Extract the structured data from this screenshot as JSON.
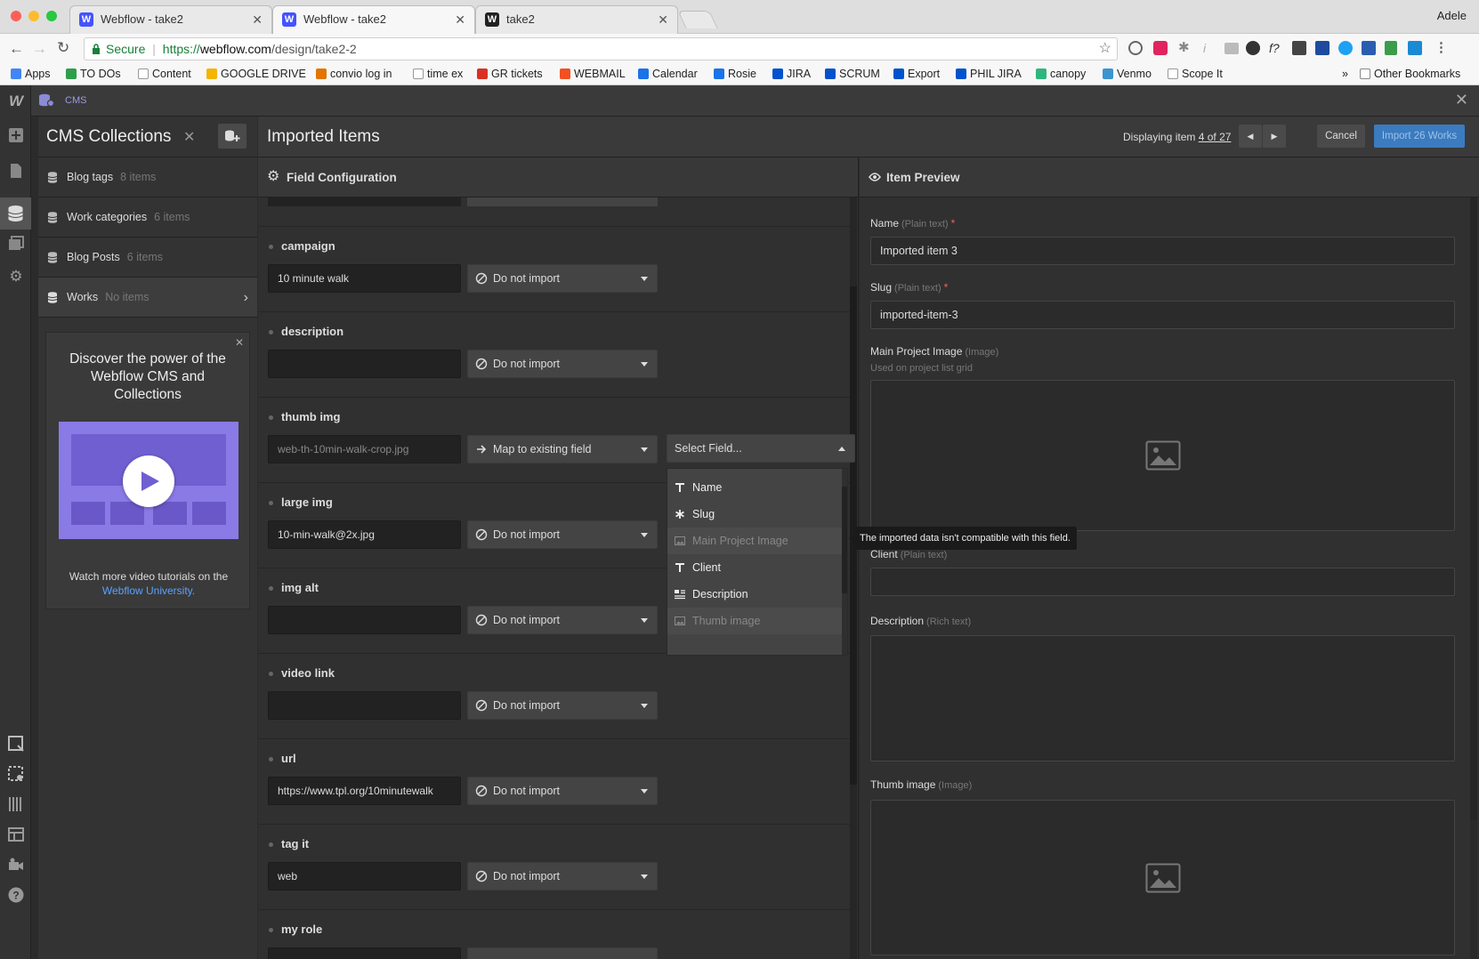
{
  "browser": {
    "tabs": [
      {
        "title": "Webflow - take2",
        "favicon": "webflow-w-icon"
      },
      {
        "title": "Webflow - take2",
        "favicon": "webflow-w-icon"
      },
      {
        "title": "take2",
        "favicon": "webflow-w-icon"
      }
    ],
    "user": "Adele",
    "secure_label": "Secure",
    "url_scheme": "https://",
    "url_host": "webflow.com",
    "url_path": "/design/take2-2",
    "bookmarks": [
      {
        "label": "Apps",
        "color": "#4285f4"
      },
      {
        "label": "TO DOs",
        "color": "#2e9e4a"
      },
      {
        "label": "Content",
        "color": "#999999"
      },
      {
        "label": "GOOGLE DRIVE",
        "color": "#f4b400"
      },
      {
        "label": "convio log in",
        "color": "#e37400"
      },
      {
        "label": "time ex",
        "color": "#999999"
      },
      {
        "label": "GR tickets",
        "color": "#d93025"
      },
      {
        "label": "WEBMAIL",
        "color": "#f25022"
      },
      {
        "label": "Calendar",
        "color": "#1a73e8"
      },
      {
        "label": "Rosie",
        "color": "#1a73e8"
      },
      {
        "label": "JIRA",
        "color": "#0052cc"
      },
      {
        "label": "SCRUM",
        "color": "#0052cc"
      },
      {
        "label": "Export",
        "color": "#0052cc"
      },
      {
        "label": "PHIL JIRA",
        "color": "#0052cc"
      },
      {
        "label": "canopy",
        "color": "#2eb67d"
      },
      {
        "label": "Venmo",
        "color": "#3d95ce"
      },
      {
        "label": "Scope It",
        "color": "#999999"
      }
    ],
    "overflow_label": "»",
    "other_bookmarks": "Other Bookmarks"
  },
  "cms": {
    "top_label": "CMS",
    "collections_title": "CMS Collections",
    "collections": [
      {
        "name": "Blog tags",
        "count": "8 items"
      },
      {
        "name": "Work categories",
        "count": "6 items"
      },
      {
        "name": "Blog Posts",
        "count": "6 items"
      },
      {
        "name": "Works",
        "count": "No items"
      }
    ],
    "promo": {
      "title": "Discover the power of the Webflow CMS and Collections",
      "footer_text": "Watch more video tutorials on the",
      "link_text": "Webflow University",
      "link_suffix": "."
    }
  },
  "import": {
    "title": "Imported Items",
    "display_prefix": "Displaying item",
    "display_link": "4 of 27",
    "cancel_label": "Cancel",
    "import_label": "Import 26 Works",
    "field_config_title": "Field Configuration",
    "item_preview_title": "Item Preview",
    "fields": [
      {
        "name": "campaign",
        "value": "10 minute walk",
        "action": "Do not import"
      },
      {
        "name": "description",
        "value": "",
        "action": "Do not import"
      },
      {
        "name": "thumb img",
        "value": "web-th-10min-walk-crop.jpg",
        "action": "Map to existing field"
      },
      {
        "name": "large img",
        "value": "10-min-walk@2x.jpg",
        "action": "Do not import"
      },
      {
        "name": "img alt",
        "value": "",
        "action": "Do not import"
      },
      {
        "name": "video link",
        "value": "",
        "action": "Do not import"
      },
      {
        "name": "url",
        "value": "https://www.tpl.org/10minutewalk",
        "action": "Do not import"
      },
      {
        "name": "tag it",
        "value": "web",
        "action": "Do not import"
      },
      {
        "name": "my role",
        "value": "",
        "action": ""
      }
    ],
    "select_field": {
      "placeholder": "Select Field...",
      "options": [
        {
          "label": "Name",
          "icon": "text-icon",
          "disabled": false
        },
        {
          "label": "Slug",
          "icon": "asterisk-icon",
          "disabled": false
        },
        {
          "label": "Main Project Image",
          "icon": "image-icon",
          "disabled": true
        },
        {
          "label": "Client",
          "icon": "text-icon",
          "disabled": false
        },
        {
          "label": "Description",
          "icon": "rich-text-icon",
          "disabled": false
        },
        {
          "label": "Thumb image",
          "icon": "image-icon",
          "disabled": true
        }
      ]
    },
    "tooltip": "The imported data isn't compatible with this field.",
    "preview": {
      "name_label": "Name",
      "name_type": "(Plain text)",
      "name_value": "Imported item 3",
      "slug_label": "Slug",
      "slug_type": "(Plain text)",
      "slug_value": "imported-item-3",
      "main_image_label": "Main Project Image",
      "main_image_type": "(Image)",
      "main_image_help": "Used on project list grid",
      "client_label": "Client",
      "client_type": "(Plain text)",
      "client_value": "",
      "description_label": "Description",
      "description_type": "(Rich text)",
      "thumb_label": "Thumb image",
      "thumb_type": "(Image)",
      "required_mark": "*"
    }
  },
  "colors": {
    "accent": "#4353ff",
    "import_button": "#3b7bbf",
    "link": "#5aa2ff",
    "required": "#ff5c5c"
  }
}
